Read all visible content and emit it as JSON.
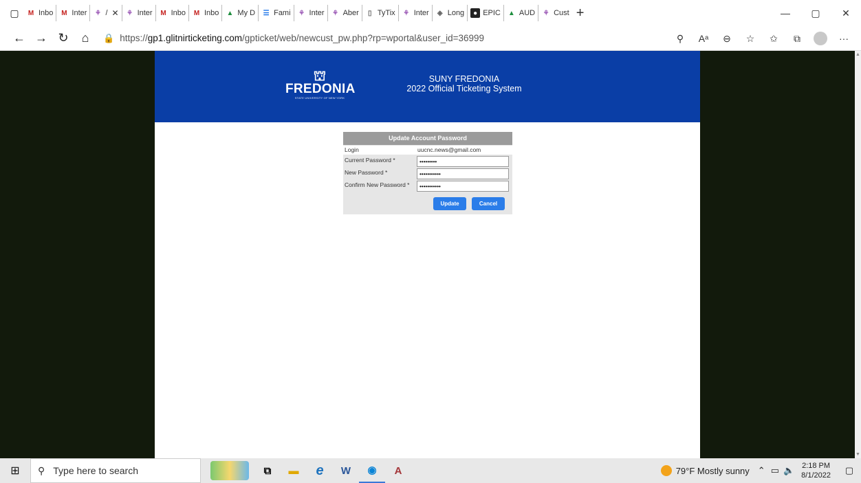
{
  "browser": {
    "tabs": [
      {
        "label": "Inbo",
        "icon": "gmail-icon",
        "glyph": "M",
        "cls": "fav-gmail"
      },
      {
        "label": "Inter",
        "icon": "gmail-icon",
        "glyph": "M",
        "cls": "fav-gmail"
      },
      {
        "label": "/",
        "icon": "ticket-icon",
        "glyph": "⚘",
        "cls": "fav-purple",
        "active": true
      },
      {
        "label": "Inter",
        "icon": "ticket-icon",
        "glyph": "⚘",
        "cls": "fav-purple"
      },
      {
        "label": "Inbo",
        "icon": "gmail-icon",
        "glyph": "M",
        "cls": "fav-gmail"
      },
      {
        "label": "Inbo",
        "icon": "gmail-icon",
        "glyph": "M",
        "cls": "fav-gmail"
      },
      {
        "label": "My D",
        "icon": "drive-icon",
        "glyph": "▲",
        "cls": "fav-drive"
      },
      {
        "label": "Fami",
        "icon": "doc-icon",
        "glyph": "☰",
        "cls": "fav-doc"
      },
      {
        "label": "Inter",
        "icon": "ticket-icon",
        "glyph": "⚘",
        "cls": "fav-purple"
      },
      {
        "label": "Aber",
        "icon": "ticket-icon",
        "glyph": "⚘",
        "cls": "fav-purple"
      },
      {
        "label": "TyTix",
        "icon": "page-icon",
        "glyph": "▯",
        "cls": "fav-page"
      },
      {
        "label": "Inter",
        "icon": "ticket-icon",
        "glyph": "⚘",
        "cls": "fav-purple"
      },
      {
        "label": "Long",
        "icon": "page-icon",
        "glyph": "◈",
        "cls": "fav-page"
      },
      {
        "label": "EPIC",
        "icon": "epic-icon",
        "glyph": "●",
        "cls": "fav-epic"
      },
      {
        "label": "AUD",
        "icon": "drive-icon",
        "glyph": "▲",
        "cls": "fav-drive"
      },
      {
        "label": "Cust",
        "icon": "ticket-icon",
        "glyph": "⚘",
        "cls": "fav-purple"
      }
    ],
    "url_prefix": "https://",
    "url_host": "gp1.glitnirticketing.com",
    "url_path": "/gpticket/web/newcust_pw.php?rp=wportal&user_id=36999"
  },
  "page": {
    "logo_word": "FREDONIA",
    "logo_sub": "STATE UNIVERSITY OF NEW YORK",
    "title_line1": "SUNY FREDONIA",
    "title_line2": "2022 Official Ticketing System"
  },
  "form": {
    "heading": "Update Account Password",
    "login_label": "Login",
    "login_value": "uucnc.news@gmail.com",
    "current_label": "Current Password *",
    "current_value": "•••••••••",
    "new_label": "New Password *",
    "new_value": "•••••••••••",
    "confirm_label": "Confirm New Password *",
    "confirm_value": "•••••••••••",
    "update_label": "Update",
    "cancel_label": "Cancel"
  },
  "taskbar": {
    "search_placeholder": "Type here to search",
    "weather": "79°F  Mostly sunny",
    "time": "2:18 PM",
    "date": "8/1/2022"
  }
}
